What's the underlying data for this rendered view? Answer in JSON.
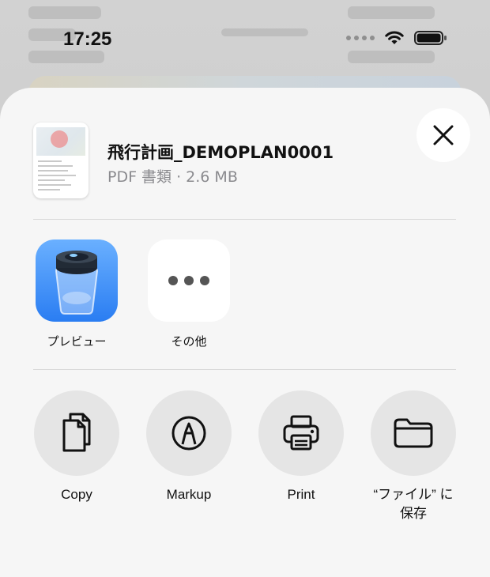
{
  "status_bar": {
    "time": "17:25",
    "icons": [
      "signal-dots-icon",
      "wifi-icon",
      "battery-icon"
    ]
  },
  "document": {
    "title": "飛行計画_DEMOPLAN0001",
    "meta": "PDF 書類 · 2.6 MB",
    "thumbnail": "pdf-thumbnail"
  },
  "apps": [
    {
      "label": "プレビュー",
      "icon": "preview-app-icon"
    },
    {
      "label": "その他",
      "icon": "more-icon"
    }
  ],
  "actions": [
    {
      "label": "Copy",
      "icon": "copy-icon"
    },
    {
      "label": "Markup",
      "icon": "markup-icon"
    },
    {
      "label": "Print",
      "icon": "print-icon"
    },
    {
      "label": "“ファイル” に保存",
      "icon": "folder-icon"
    }
  ],
  "colors": {
    "sheet_bg": "#f6f6f6",
    "action_circle": "#e5e5e5",
    "secondary_text": "#8a8a8e",
    "preview_blue": "#2a7df2"
  }
}
